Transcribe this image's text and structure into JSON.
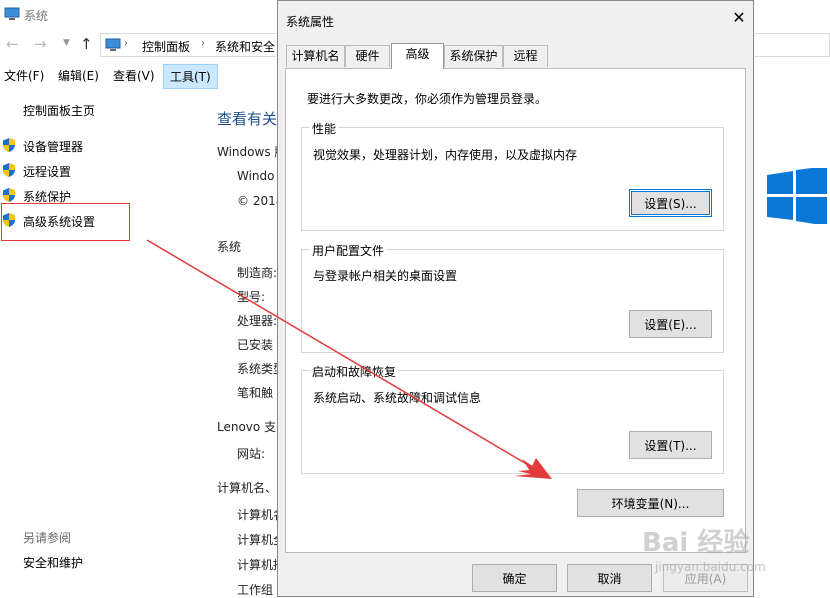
{
  "bg_window": {
    "title": "系统",
    "breadcrumb": [
      "控制面板",
      "系统和安全"
    ],
    "menu": [
      "文件(F)",
      "编辑(E)",
      "查看(V)",
      "工具(T)"
    ],
    "sidebar": {
      "home": "控制面板主页",
      "links": [
        "设备管理器",
        "远程设置",
        "系统保护",
        "高级系统设置"
      ],
      "see_also_heading": "另请参阅",
      "see_also": [
        "安全和维护"
      ]
    },
    "main": {
      "heading": "查看有关",
      "windows_edition": "Windows 版",
      "windows_name": "Windo",
      "copyright": "© 2018",
      "system_section": "系统",
      "system_fields": [
        "制造商:",
        "型号:",
        "处理器:",
        "已安装",
        "系统类型",
        "笔和触"
      ],
      "lenovo_section": "Lenovo 支",
      "website": "网站:",
      "computer_section": "计算机名、",
      "computer_fields": [
        "计算机名",
        "计算机全",
        "计算机描",
        "工作组"
      ]
    }
  },
  "dialog": {
    "title": "系统属性",
    "close": "✕",
    "tabs": [
      "计算机名",
      "硬件",
      "高级",
      "系统保护",
      "远程"
    ],
    "active_tab": "高级",
    "admin_note": "要进行大多数更改，你必须作为管理员登录。",
    "performance": {
      "label": "性能",
      "desc": "视觉效果，处理器计划，内存使用，以及虚拟内存",
      "button": "设置(S)..."
    },
    "profile": {
      "label": "用户配置文件",
      "desc": "与登录帐户相关的桌面设置",
      "button": "设置(E)..."
    },
    "startup": {
      "label": "启动和故障恢复",
      "desc": "系统启动、系统故障和调试信息",
      "button": "设置(T)..."
    },
    "env_button": "环境变量(N)...",
    "ok": "确定",
    "cancel": "取消",
    "apply": "应用(A)"
  },
  "watermark": {
    "brand": "Bai 经验",
    "url": "jingyan.baidu.com"
  },
  "colors": {
    "annotation_red": "#e23b3b",
    "windows_blue": "#0a78d4",
    "focus_blue": "#0078d7"
  }
}
